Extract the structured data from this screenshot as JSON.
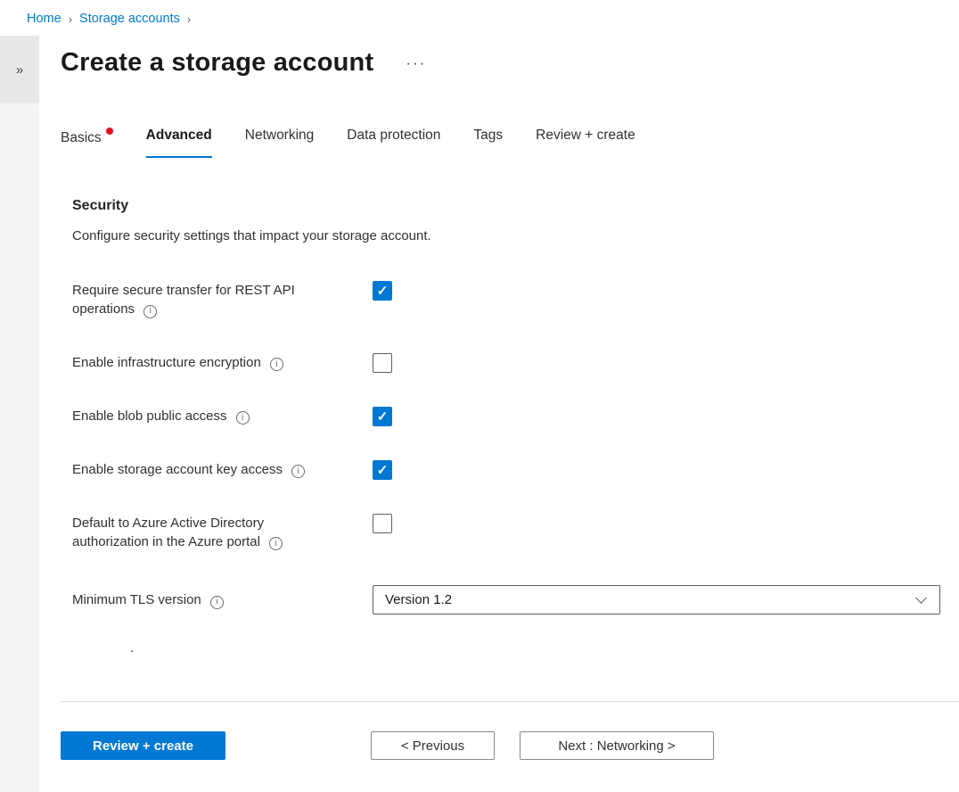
{
  "breadcrumb": {
    "items": [
      {
        "label": "Home"
      },
      {
        "label": "Storage accounts"
      }
    ],
    "separator": "›"
  },
  "sidebar": {
    "expand_icon": "»"
  },
  "header": {
    "title": "Create a storage account",
    "more_icon": "···"
  },
  "tabs": [
    {
      "label": "Basics",
      "active": false,
      "has_error": true
    },
    {
      "label": "Advanced",
      "active": true,
      "has_error": false
    },
    {
      "label": "Networking",
      "active": false,
      "has_error": false
    },
    {
      "label": "Data protection",
      "active": false,
      "has_error": false
    },
    {
      "label": "Tags",
      "active": false,
      "has_error": false
    },
    {
      "label": "Review + create",
      "active": false,
      "has_error": false
    }
  ],
  "section": {
    "title": "Security",
    "description": "Configure security settings that impact your storage account."
  },
  "fields": [
    {
      "label": "Require secure transfer for REST API operations",
      "type": "checkbox",
      "checked": true
    },
    {
      "label": "Enable infrastructure encryption",
      "type": "checkbox",
      "checked": false
    },
    {
      "label": "Enable blob public access",
      "type": "checkbox",
      "checked": true
    },
    {
      "label": "Enable storage account key access",
      "type": "checkbox",
      "checked": true
    },
    {
      "label": "Default to Azure Active Directory authorization in the Azure portal",
      "type": "checkbox",
      "checked": false
    },
    {
      "label": "Minimum TLS version",
      "type": "select",
      "value": "Version 1.2"
    }
  ],
  "misc": {
    "stray_dot": "."
  },
  "footer": {
    "primary_button": "Review + create",
    "previous_button": "< Previous",
    "next_button": "Next : Networking >"
  },
  "colors": {
    "accent": "#0078d4",
    "error_dot": "#e81123",
    "checkbox_checked": "#0078d4",
    "link": "#0078d4"
  }
}
